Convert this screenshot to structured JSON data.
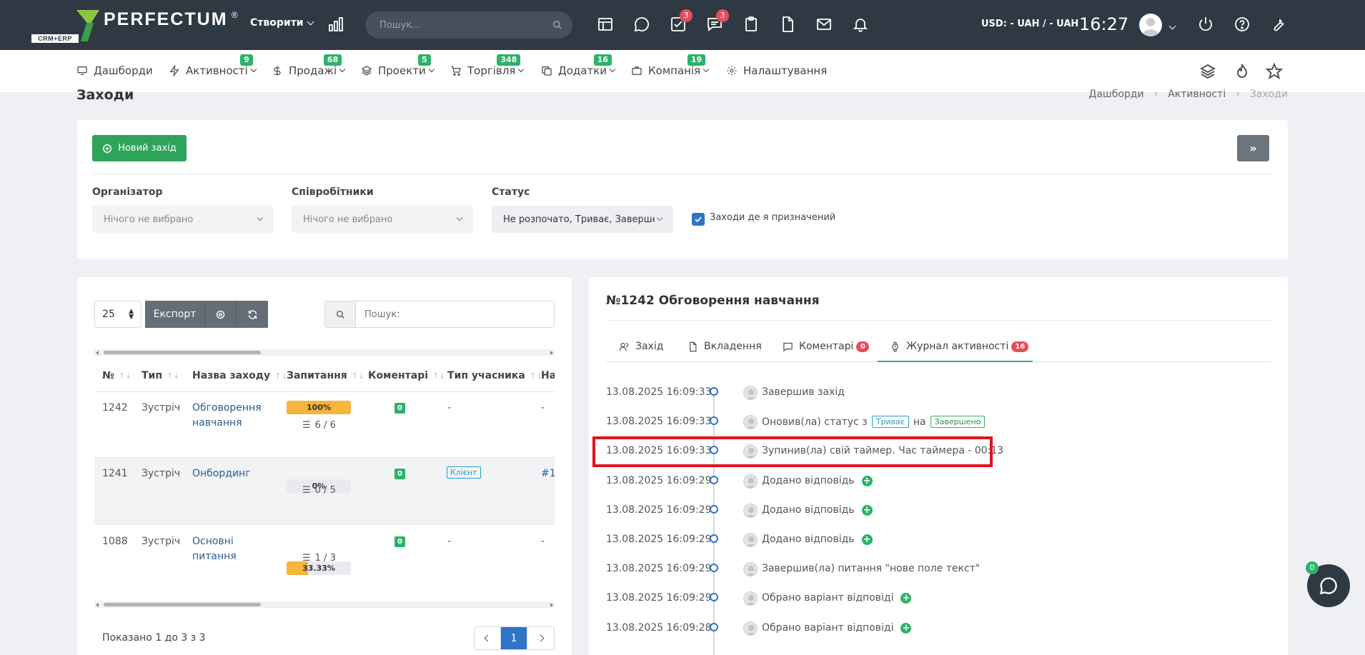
{
  "topbar": {
    "logo_text": "PERFECTUM",
    "logo_reg": "®",
    "logo_sub": "CRM+ERP",
    "create_label": "Створити",
    "search_placeholder": "Пошук...",
    "tasks_badge": "3",
    "chat_badge": "3",
    "currency": "USD: - UAH / - UAH",
    "time": "16:27"
  },
  "nav": [
    {
      "label": "Дашборди",
      "icon": "monitor-icon",
      "badge": ""
    },
    {
      "label": "Активності",
      "icon": "lightning-icon",
      "badge": "9"
    },
    {
      "label": "Продажі",
      "icon": "dollar-icon",
      "badge": "68"
    },
    {
      "label": "Проекти",
      "icon": "layers-icon",
      "badge": "5"
    },
    {
      "label": "Торгівля",
      "icon": "cart-icon",
      "badge": "348"
    },
    {
      "label": "Додатки",
      "icon": "copy-icon",
      "badge": "16"
    },
    {
      "label": "Компанія",
      "icon": "briefcase-icon",
      "badge": "19"
    },
    {
      "label": "Налаштування",
      "icon": "gear-icon",
      "badge": ""
    }
  ],
  "page": {
    "title": "Заходи",
    "breadcrumb": [
      "Дашборди",
      "Активності",
      "Заходи"
    ]
  },
  "filters": {
    "new_button": "Новий захід",
    "expand_button": "»",
    "organizer_label": "Організатор",
    "organizer_value": "Нічого не вибрано",
    "employees_label": "Співробітники",
    "employees_value": "Нічого не вибрано",
    "status_label": "Статус",
    "status_value": "Не розпочато, Триває, Завершено",
    "assigned_label": "Заходи де я призначений"
  },
  "table": {
    "page_length": "25",
    "export_label": "Експорт",
    "search_placeholder": "Пошук:",
    "columns": [
      "№",
      "Тип",
      "Назва заходу",
      "Запитання",
      "Коментарі",
      "Тип учасника",
      "На"
    ],
    "rows": [
      {
        "id": "1242",
        "type": "Зустріч",
        "name": "Обговорення навчання",
        "progress_label": "100%",
        "progress": 1.0,
        "questions": "6 / 6",
        "comments": "0",
        "participant": "-",
        "extra": "-"
      },
      {
        "id": "1241",
        "type": "Зустріч",
        "name": "Онбординг",
        "progress_label": "0%",
        "progress": 0.0,
        "questions": "0 / 5",
        "comments": "0",
        "participant": "Клієнт",
        "extra": "#1"
      },
      {
        "id": "1088",
        "type": "Зустріч",
        "name": "Основні питання",
        "progress_label": "33.33%",
        "progress": 0.3333,
        "questions": "1 / 3",
        "comments": "0",
        "participant": "-",
        "extra": "-"
      }
    ],
    "showing": "Показано 1 до 3 з 3",
    "page": "1"
  },
  "detail": {
    "title": "№1242 Обговорення навчання",
    "tabs": [
      {
        "label": "Захід",
        "badge": ""
      },
      {
        "label": "Вкладення",
        "badge": ""
      },
      {
        "label": "Коментарі",
        "badge": "0"
      },
      {
        "label": "Журнал активності",
        "badge": "16"
      }
    ],
    "timeline": [
      {
        "date": "13.08.2025 16:09:33",
        "text": "Завершив захід"
      },
      {
        "date": "13.08.2025 16:09:33",
        "text": "Оновив(ла) статус з",
        "from": "Триває",
        "mid": "на",
        "to": "Завершено"
      },
      {
        "date": "13.08.2025 16:09:33",
        "text": "Зупинив(ла) свій таймер. Час таймера - 00:13"
      },
      {
        "date": "13.08.2025 16:09:29",
        "text": "Додано відповідь",
        "plus": "+"
      },
      {
        "date": "13.08.2025 16:09:29",
        "text": "Додано відповідь",
        "plus": "+"
      },
      {
        "date": "13.08.2025 16:09:29",
        "text": "Додано відповідь",
        "plus": "+"
      },
      {
        "date": "13.08.2025 16:09:29",
        "text": "Завершив(ла) питання \"нове поле текст\""
      },
      {
        "date": "13.08.2025 16:09:29",
        "text": "Обрано варіант відповіді",
        "plus": "+"
      },
      {
        "date": "13.08.2025 16:09:28",
        "text": "Обрано варіант відповіді",
        "plus": "+"
      }
    ]
  },
  "chat_widget": {
    "badge": "0"
  },
  "colors": {
    "topbar": "#2f3944",
    "accent_green": "#2cb36a",
    "accent_blue": "#2e74c7",
    "badge_red": "#e74c5b",
    "highlight": "#e0141e",
    "progress_fill": "#f6b53c"
  }
}
